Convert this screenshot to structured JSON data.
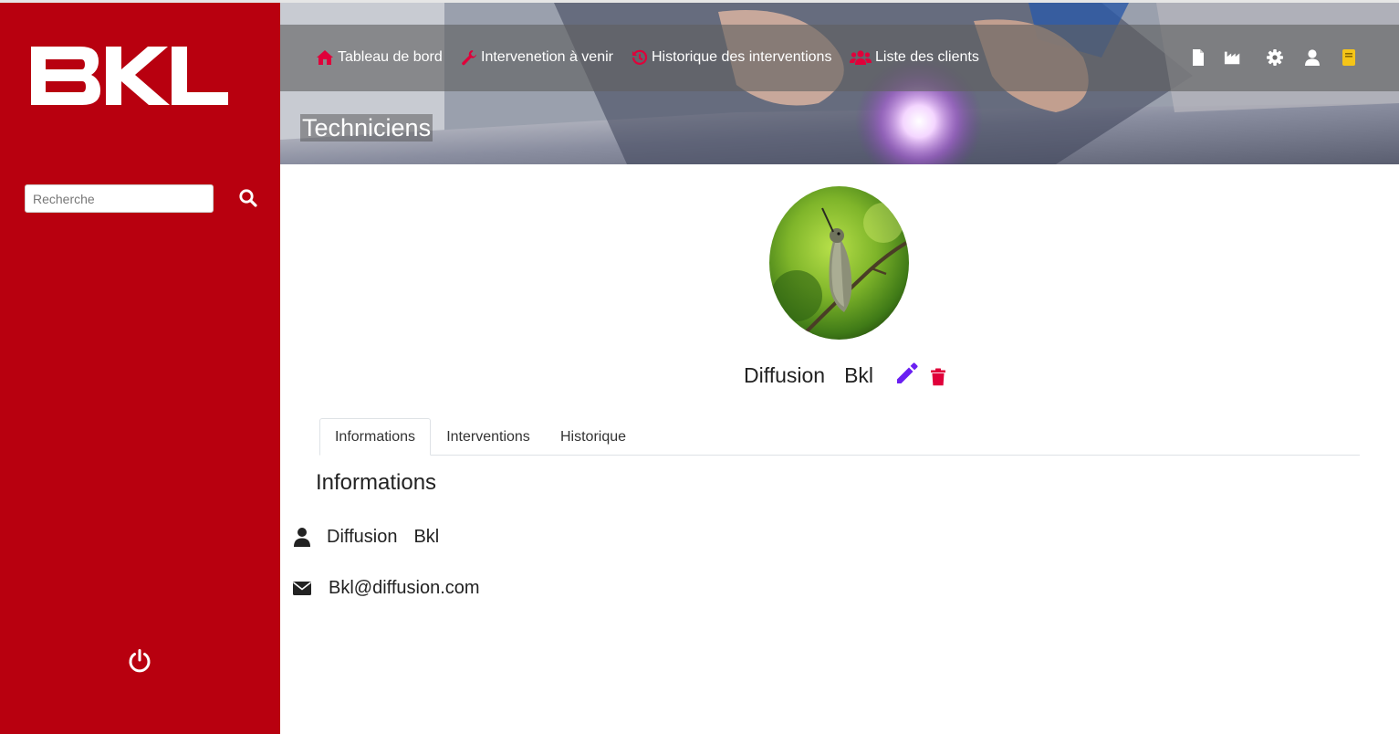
{
  "brand": {
    "logo_text": "BKL",
    "color": "#b8000f",
    "accent": "#e0003a"
  },
  "sidebar": {
    "search": {
      "placeholder": "Recherche",
      "value": ""
    },
    "icons": {
      "search": "search-icon",
      "power": "power-icon"
    }
  },
  "nav": {
    "items": [
      {
        "label": "Tableau de bord",
        "icon": "home-icon"
      },
      {
        "label": "Intervenetion à venir",
        "icon": "wrench-icon"
      },
      {
        "label": "Historique des interventions",
        "icon": "history-icon"
      },
      {
        "label": "Liste des clients",
        "icon": "users-icon"
      }
    ],
    "right_icons": [
      "file-icon",
      "factory-icon",
      "gear-icon",
      "user-icon",
      "book-icon"
    ]
  },
  "page": {
    "heading": "Techniciens"
  },
  "profile": {
    "first_name": "Diffusion",
    "last_name": "Bkl",
    "avatar": "hummingbird-photo",
    "edit_color": "#6a1ff2",
    "delete_color": "#e0003a"
  },
  "tabs": [
    {
      "label": "Informations",
      "active": true
    },
    {
      "label": "Interventions",
      "active": false
    },
    {
      "label": "Historique",
      "active": false
    }
  ],
  "info": {
    "title": "Informations",
    "first_name": "Diffusion",
    "last_name": "Bkl",
    "email": "Bkl@diffusion.com"
  }
}
